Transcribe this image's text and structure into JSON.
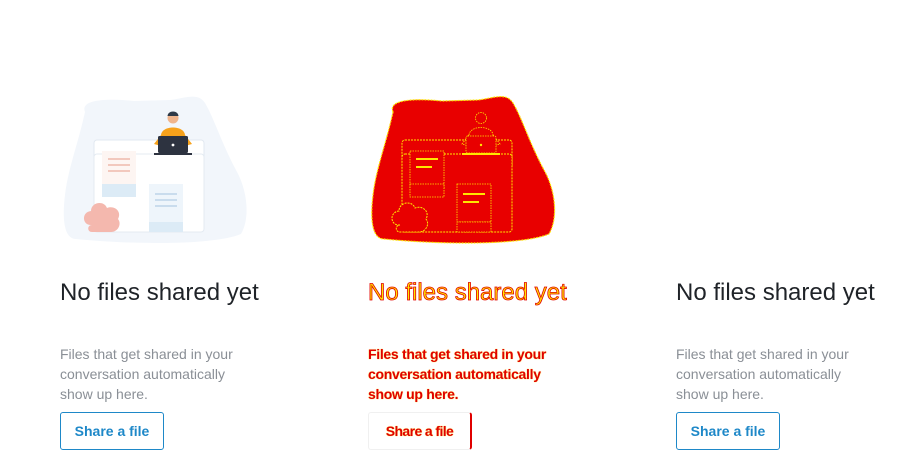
{
  "empty_states": [
    {
      "title": "No files shared yet",
      "description": "Files that get shared in your conversation automatically show up here.",
      "button_label": "Share a file",
      "icon": "files-illustration-icon"
    },
    {
      "title": "No files shared yet",
      "description": "Files that get shared in your conversation automatically show up here.",
      "button_label": "Share a file",
      "icon": "files-illustration-icon-red-highlighted"
    },
    {
      "title": "No files shared yet",
      "description": "Files that get shared in your conversation automatically show up here.",
      "button_label": "Share a file",
      "icon": "files-illustration-icon"
    }
  ],
  "colors": {
    "accent": "#1e88c8",
    "title": "#1f2328",
    "description": "#8a8f96",
    "highlight_red": "#e00000",
    "highlight_yellow": "#ffe600"
  }
}
